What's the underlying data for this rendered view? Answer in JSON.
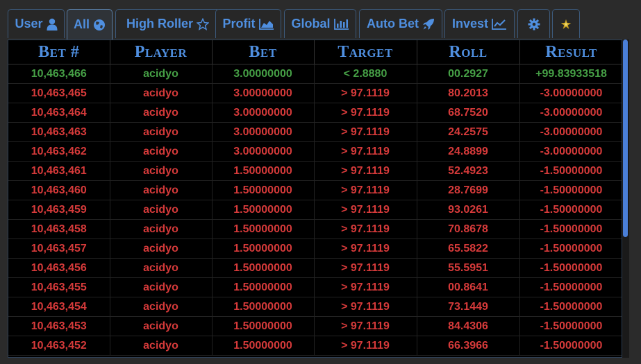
{
  "tabs": [
    {
      "label": "User",
      "icon": "user-icon"
    },
    {
      "label": "All",
      "icon": "globe-icon"
    },
    {
      "label": "High Roller",
      "icon": "star-icon"
    },
    {
      "label": "Profit",
      "icon": "area-chart-icon"
    },
    {
      "label": "Global",
      "icon": "bar-chart-icon"
    },
    {
      "label": "Auto Bet",
      "icon": "rocket-icon"
    },
    {
      "label": "Invest",
      "icon": "line-chart-icon"
    },
    {
      "label": "",
      "icon": "gear-icon"
    },
    {
      "label": "",
      "icon": "sparkle-star-icon"
    }
  ],
  "active_tab": "All",
  "colors": {
    "accent": "#4f8fe0",
    "win": "#46a046",
    "loss": "#d63a3a"
  },
  "table": {
    "headers": [
      "Bet #",
      "Player",
      "Bet",
      "Target",
      "Roll",
      "Result"
    ],
    "rows": [
      {
        "status": "win",
        "cells": [
          "10,463,466",
          "acidyo",
          "3.00000000",
          "< 2.8880",
          "00.2927",
          "+99.83933518"
        ]
      },
      {
        "status": "loss",
        "cells": [
          "10,463,465",
          "acidyo",
          "3.00000000",
          "> 97.1119",
          "80.2013",
          "-3.00000000"
        ]
      },
      {
        "status": "loss",
        "cells": [
          "10,463,464",
          "acidyo",
          "3.00000000",
          "> 97.1119",
          "68.7520",
          "-3.00000000"
        ]
      },
      {
        "status": "loss",
        "cells": [
          "10,463,463",
          "acidyo",
          "3.00000000",
          "> 97.1119",
          "24.2575",
          "-3.00000000"
        ]
      },
      {
        "status": "loss",
        "cells": [
          "10,463,462",
          "acidyo",
          "3.00000000",
          "> 97.1119",
          "24.8899",
          "-3.00000000"
        ]
      },
      {
        "status": "loss",
        "cells": [
          "10,463,461",
          "acidyo",
          "1.50000000",
          "> 97.1119",
          "52.4923",
          "-1.50000000"
        ]
      },
      {
        "status": "loss",
        "cells": [
          "10,463,460",
          "acidyo",
          "1.50000000",
          "> 97.1119",
          "28.7699",
          "-1.50000000"
        ]
      },
      {
        "status": "loss",
        "cells": [
          "10,463,459",
          "acidyo",
          "1.50000000",
          "> 97.1119",
          "93.0261",
          "-1.50000000"
        ]
      },
      {
        "status": "loss",
        "cells": [
          "10,463,458",
          "acidyo",
          "1.50000000",
          "> 97.1119",
          "70.8678",
          "-1.50000000"
        ]
      },
      {
        "status": "loss",
        "cells": [
          "10,463,457",
          "acidyo",
          "1.50000000",
          "> 97.1119",
          "65.5822",
          "-1.50000000"
        ]
      },
      {
        "status": "loss",
        "cells": [
          "10,463,456",
          "acidyo",
          "1.50000000",
          "> 97.1119",
          "55.5951",
          "-1.50000000"
        ]
      },
      {
        "status": "loss",
        "cells": [
          "10,463,455",
          "acidyo",
          "1.50000000",
          "> 97.1119",
          "00.8641",
          "-1.50000000"
        ]
      },
      {
        "status": "loss",
        "cells": [
          "10,463,454",
          "acidyo",
          "1.50000000",
          "> 97.1119",
          "73.1449",
          "-1.50000000"
        ]
      },
      {
        "status": "loss",
        "cells": [
          "10,463,453",
          "acidyo",
          "1.50000000",
          "> 97.1119",
          "84.4306",
          "-1.50000000"
        ]
      },
      {
        "status": "loss",
        "cells": [
          "10,463,452",
          "acidyo",
          "1.50000000",
          "> 97.1119",
          "66.3966",
          "-1.50000000"
        ]
      }
    ]
  }
}
